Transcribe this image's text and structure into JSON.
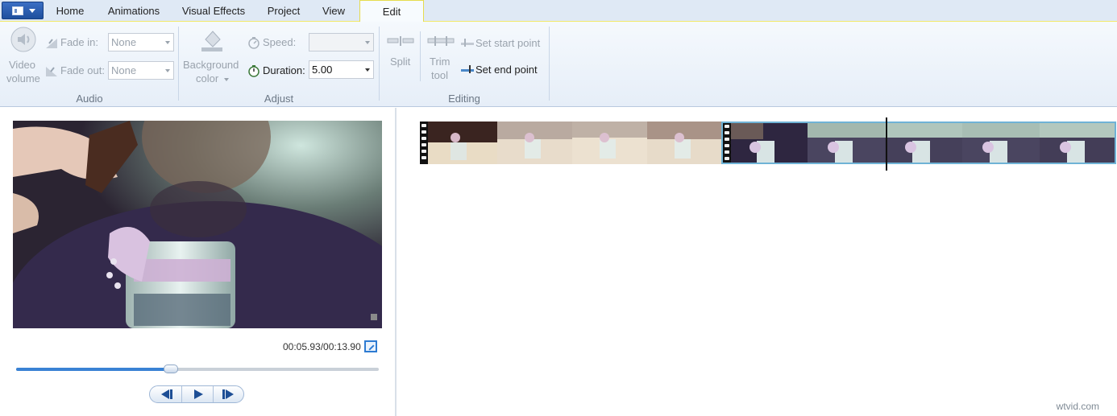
{
  "tabs": [
    {
      "label": "Home"
    },
    {
      "label": "Animations"
    },
    {
      "label": "Visual Effects"
    },
    {
      "label": "Project"
    },
    {
      "label": "View"
    },
    {
      "label": "Edit"
    }
  ],
  "active_tab": "Edit",
  "ribbon": {
    "audio": {
      "group_label": "Audio",
      "video_volume_line1": "Video",
      "video_volume_line2": "volume",
      "fade_in_label": "Fade in:",
      "fade_in_value": "None",
      "fade_out_label": "Fade out:",
      "fade_out_value": "None"
    },
    "adjust": {
      "group_label": "Adjust",
      "background_line1": "Background",
      "background_line2": "color",
      "speed_label": "Speed:",
      "speed_value": "",
      "duration_label": "Duration:",
      "duration_value": "5.00"
    },
    "editing": {
      "group_label": "Editing",
      "split_label": "Split",
      "trim_line1": "Trim",
      "trim_line2": "tool",
      "set_start_label": "Set start point",
      "set_end_label": "Set end point"
    }
  },
  "player": {
    "timecode": "00:05.93/00:13.90",
    "progress": 0.427
  },
  "storyboard": {
    "clips": [
      {
        "frames": 4,
        "tone": "warm"
      },
      {
        "frames": 5,
        "tone": "cool",
        "selected": true
      }
    ]
  },
  "watermark": "wtvid.com",
  "colors": {
    "accent": "#3a82d4",
    "selection": "#6fb3d6",
    "ribbon_bg": "#e6eef8"
  }
}
